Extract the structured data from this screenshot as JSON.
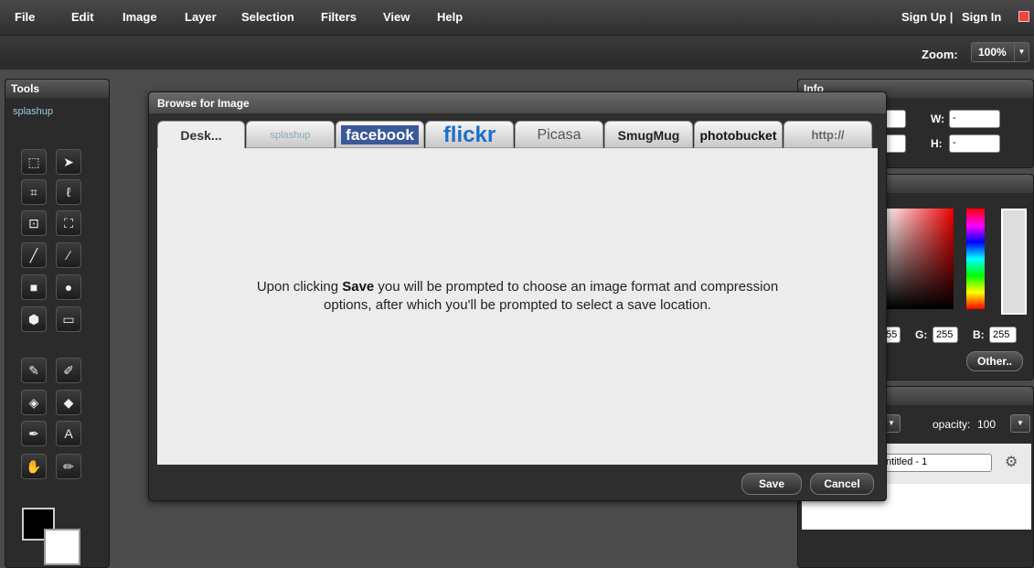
{
  "menu": {
    "items": [
      "File",
      "Edit",
      "Image",
      "Layer",
      "Selection",
      "Filters",
      "View",
      "Help"
    ],
    "sign_up": "Sign Up |",
    "sign_in": "Sign In"
  },
  "zoom": {
    "label": "Zoom:",
    "value": "100%"
  },
  "tools": {
    "title": "Tools",
    "logo": "splashup"
  },
  "info_panel": {
    "title": "Info",
    "w_label": "W:",
    "w_value": "-",
    "h_label": "H:",
    "h_value": "-"
  },
  "color_panel": {
    "r_value": "55",
    "g_label": "G:",
    "g_value": "255",
    "b_label": "B:",
    "b_value": "255",
    "other_button": "Other.."
  },
  "layers_panel": {
    "opacity_label": "opacity:",
    "opacity_value": "100",
    "layer_name": "ntitled - 1"
  },
  "dialog": {
    "title": "Browse for Image",
    "tabs": {
      "desktop": "Desk...",
      "splashup": "splashup",
      "facebook": "facebook",
      "flickr": "flickr",
      "picasa": "Picasa",
      "smugmug": "SmugMug",
      "photobucket": "photobucket",
      "http": "http://"
    },
    "message_pre": "Upon clicking ",
    "message_bold": "Save",
    "message_post": " you will be prompted to choose an image format and compression options, after which you'll be prompted to select a save location.",
    "save_button": "Save",
    "cancel_button": "Cancel"
  }
}
